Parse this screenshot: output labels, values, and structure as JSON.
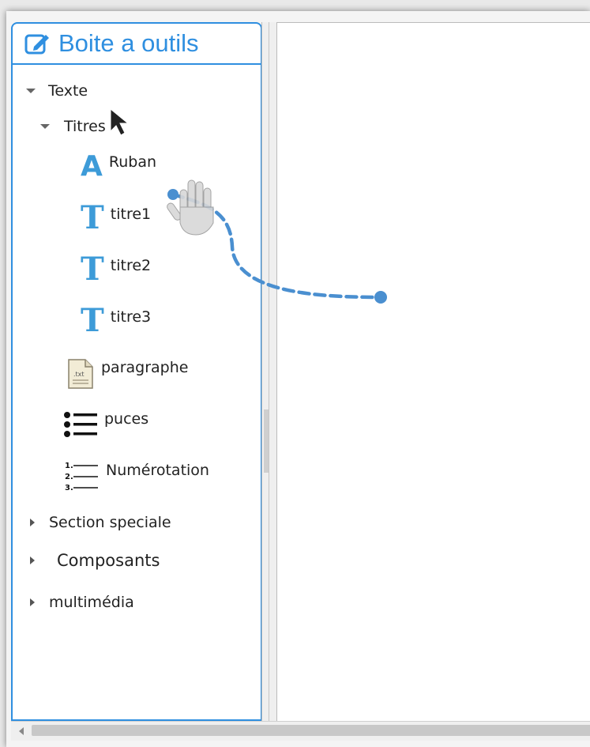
{
  "toolbox": {
    "title": "Boite a outils",
    "tree": {
      "texte": "Texte",
      "titres": "Titres",
      "ruban": "Ruban",
      "titre1": "titre1",
      "titre2": "titre2",
      "titre3": "titre3",
      "paragraphe": "paragraphe",
      "paragraphe_icon_text": ".txt",
      "puces": "puces",
      "numerotation": "Numérotation",
      "section_speciale": "Section speciale",
      "composants": "Composants",
      "multimedia": "multimédia"
    }
  },
  "icons": {
    "header": "edit-icon",
    "ruban": "letter-a-icon",
    "titre": "letter-t-icon",
    "paragraphe": "text-file-icon",
    "puces": "bulleted-list-icon",
    "numerotation": "numbered-list-icon",
    "cursor": "arrow-cursor-icon",
    "drag": "grab-hand-icon"
  },
  "colors": {
    "accent": "#2f8fe0",
    "icon_blue": "#3d9bd8",
    "drag_path": "#4a8fd0"
  }
}
